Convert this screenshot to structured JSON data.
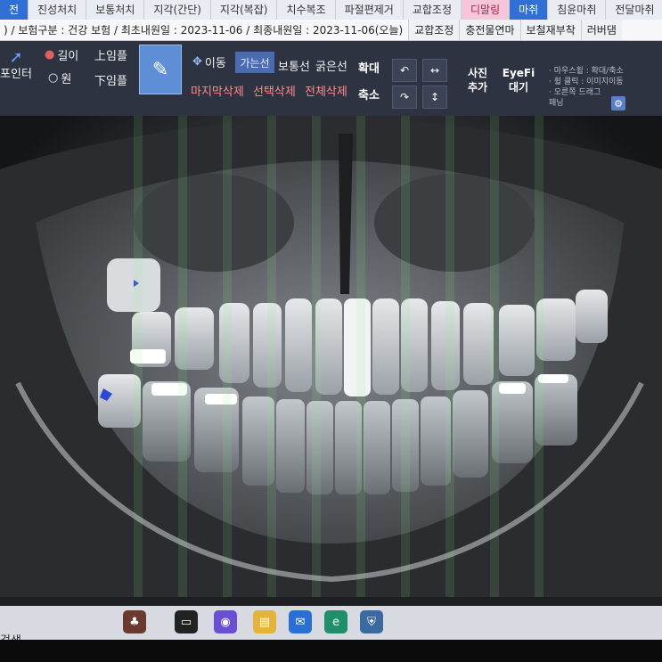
{
  "top_tabs": [
    {
      "label": "전",
      "style": "blue"
    },
    {
      "label": "진성처치",
      "style": "plain"
    },
    {
      "label": "보통처치",
      "style": "plain"
    },
    {
      "label": "지각(간단)",
      "style": "plain"
    },
    {
      "label": "지각(복잡)",
      "style": "plain"
    },
    {
      "label": "치수복조",
      "style": "plain"
    },
    {
      "label": "파절편제거",
      "style": "plain"
    },
    {
      "label": "교합조정",
      "style": "plain"
    },
    {
      "label": "디말링",
      "style": "pink"
    },
    {
      "label": "마취",
      "style": "blue"
    },
    {
      "label": "침윤마취",
      "style": "plain"
    },
    {
      "label": "전달마취",
      "style": "plain"
    }
  ],
  "info_row": {
    "text": ") / 보험구분 : 건강 보험 / 최초내원일 : 2023-11-06 / 최종내원일 : 2023-11-06(오늘)",
    "tabs": [
      "교합조정",
      "충전물연마",
      "보철재부착",
      "러버댐"
    ]
  },
  "toolbar": {
    "pointer": "포인터",
    "length": "길이",
    "circle": "원",
    "upper_impression": "上임플",
    "lower_impression": "下임플",
    "brush": "펜",
    "move": "이동",
    "thin_line": "가는선",
    "normal_line": "보통선",
    "thick_line": "굵은선",
    "delete_last": "마지막삭제",
    "delete_selected": "선택삭제",
    "delete_all": "전체삭제",
    "zoom_in": "확대",
    "zoom_out": "축소",
    "photo_add": "사진\n추가",
    "eyefi": "EyeFi\n대기",
    "options": [
      "· 마우스휠 : 확대/축소",
      "· 휠 클릭 : 이미지이동",
      "· 오른쪽 드래그",
      "  패닝"
    ]
  },
  "viewer": {
    "image": "panoramic dental x-ray"
  },
  "taskbar": {
    "search": "검색",
    "icons": [
      "game-icon",
      "taskview-icon",
      "chat-icon",
      "folder-icon",
      "mail-icon",
      "edge-icon",
      "dental-app-icon"
    ]
  }
}
